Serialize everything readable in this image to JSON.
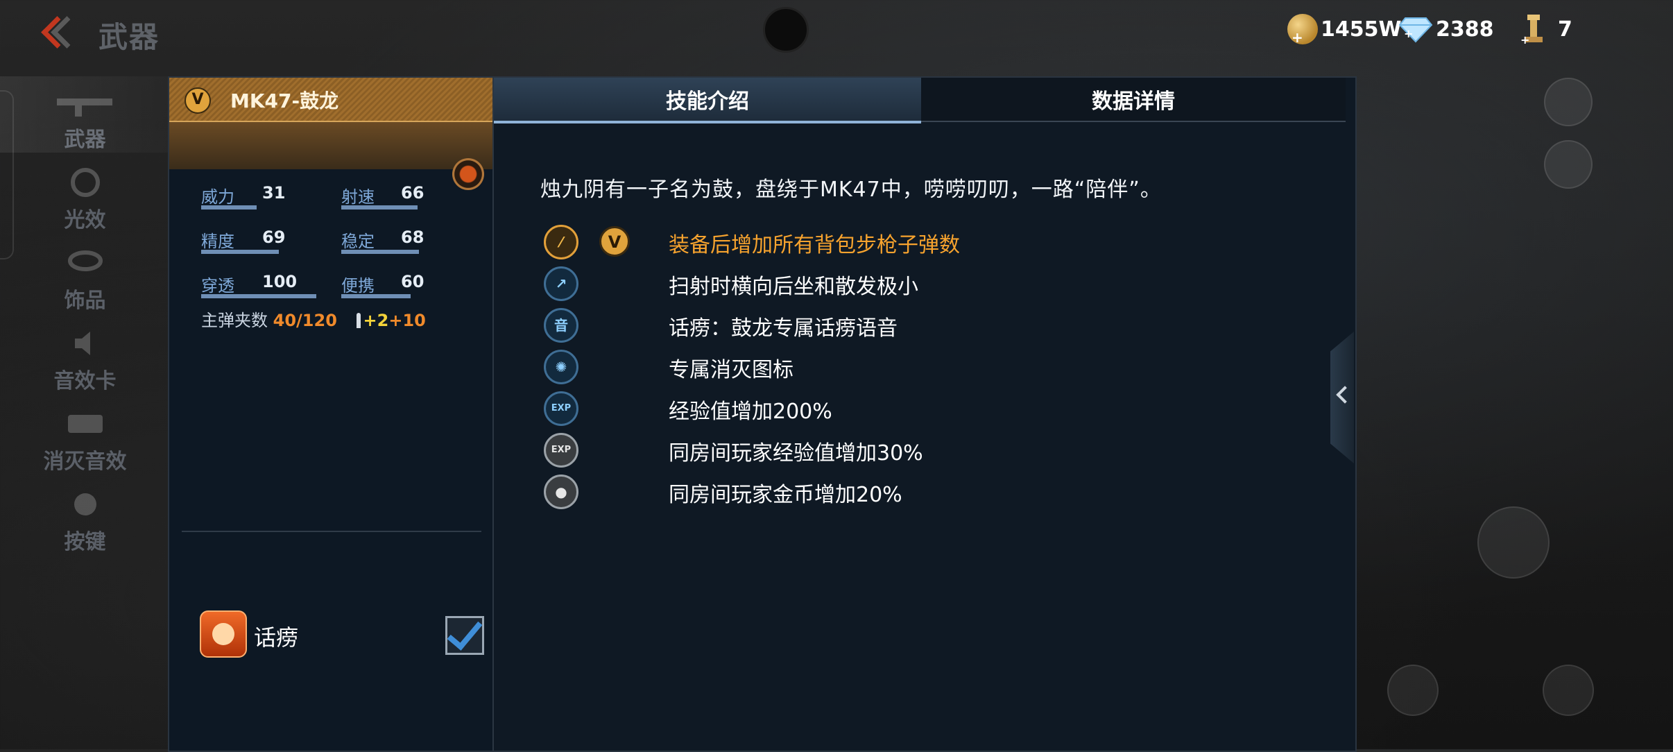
{
  "header": {
    "title": "武器",
    "gold": "1455W",
    "diamonds": "2388",
    "trophies": "7"
  },
  "nav": {
    "items": [
      {
        "label": "武器",
        "icon": "rifle-icon"
      },
      {
        "label": "光效",
        "icon": "light-effect-icon"
      },
      {
        "label": "饰品",
        "icon": "ornament-icon"
      },
      {
        "label": "音效卡",
        "icon": "sound-card-icon"
      },
      {
        "label": "消灭音效",
        "icon": "kill-sound-icon"
      },
      {
        "label": "按键",
        "icon": "key-icon"
      }
    ]
  },
  "weapon": {
    "rank_badge": "V",
    "name": "MK47-鼓龙",
    "stats": [
      {
        "label": "威力",
        "value": "31"
      },
      {
        "label": "射速",
        "value": "66"
      },
      {
        "label": "精度",
        "value": "69"
      },
      {
        "label": "稳定",
        "value": "68"
      },
      {
        "label": "穿透",
        "value": "100"
      },
      {
        "label": "便携",
        "value": "60"
      }
    ],
    "ammo_label": "主弹夹数",
    "ammo_value": "40/120",
    "ammo_bonus_a": "+2",
    "ammo_bonus_b": "+10"
  },
  "voice": {
    "label": "话痨",
    "checked": true
  },
  "tabs": [
    {
      "label": "技能介绍",
      "active": true
    },
    {
      "label": "数据详情",
      "active": false
    }
  ],
  "skills": {
    "description": "烛九阴有一子名为鼓，盘绕于MK47中，唠唠叨叨，一路“陪伴”。",
    "items": [
      {
        "icon": "rifle-icon",
        "text": "装备后增加所有背包步枪子弹数",
        "color": "#f7a32e"
      },
      {
        "icon": "recoil-icon",
        "text": "扫射时横向后坐和散发极小",
        "color": "#ffffff"
      },
      {
        "icon": "voice-icon",
        "text": "话痨：鼓龙专属话痨语音",
        "color": "#ffffff"
      },
      {
        "icon": "kill-icon",
        "text": "专属消灭图标",
        "color": "#ffffff"
      },
      {
        "icon": "exp-icon",
        "text": "经验值增加200%",
        "color": "#ffffff"
      },
      {
        "icon": "room-exp-icon",
        "text": "同房间玩家经验值增加30%",
        "color": "#ffffff"
      },
      {
        "icon": "room-gold-icon",
        "text": "同房间玩家金币增加20%",
        "color": "#ffffff"
      }
    ]
  },
  "icon_glyphs": {
    "voice_glyph": "音",
    "exp_glyph": "EXP"
  }
}
